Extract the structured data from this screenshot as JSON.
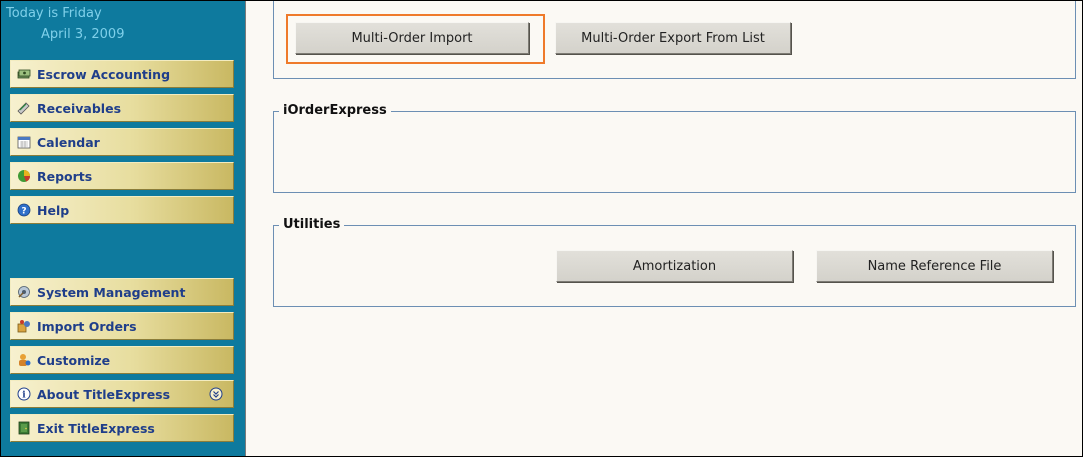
{
  "sidebar": {
    "date_line1": "Today is Friday",
    "date_line2": "April 3, 2009",
    "items": [
      {
        "label": "Escrow Accounting",
        "icon": "money-stack-icon"
      },
      {
        "label": "Receivables",
        "icon": "receivables-icon"
      },
      {
        "label": "Calendar",
        "icon": "calendar-icon"
      },
      {
        "label": "Reports",
        "icon": "reports-pie-icon"
      },
      {
        "label": "Help",
        "icon": "help-icon"
      },
      {
        "label": "System Management",
        "icon": "system-management-icon"
      },
      {
        "label": "Import Orders",
        "icon": "import-orders-icon"
      },
      {
        "label": "Customize",
        "icon": "customize-icon"
      },
      {
        "label": "About TitleExpress",
        "icon": "info-icon"
      },
      {
        "label": "Exit TitleExpress",
        "icon": "exit-door-icon"
      }
    ],
    "about_expand_icon": "chevron-double-down-icon"
  },
  "main": {
    "import_export": {
      "multi_order_import": "Multi-Order Import",
      "multi_order_export": "Multi-Order Export From List"
    },
    "iorderexpress": {
      "title": "iOrderExpress"
    },
    "utilities": {
      "title": "Utilities",
      "amortization": "Amortization",
      "name_reference_file": "Name Reference File"
    }
  },
  "colors": {
    "sidebar_bg": "#0e7a9e",
    "nav_button_text": "#1f3e8a",
    "highlight": "#ef7a2a",
    "group_border": "#6c8fb3"
  }
}
